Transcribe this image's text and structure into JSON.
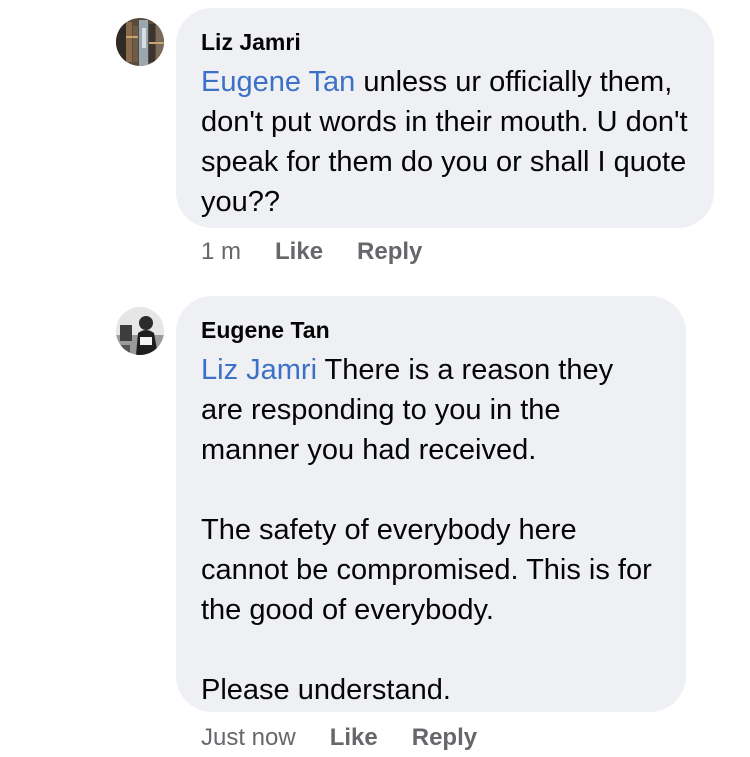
{
  "comments": [
    {
      "author": "Liz Jamri",
      "mention": "Eugene Tan",
      "text": " unless ur officially them, don't put words in their mouth. U don't speak for them do you or shall I quote you??",
      "time": "1 m",
      "like_label": "Like",
      "reply_label": "Reply"
    },
    {
      "author": "Eugene Tan",
      "mention": "Liz Jamri",
      "text": " There is a reason they are responding to you in the manner you had received.\n\nThe safety of everybody here cannot be compromised. This is for the good of everybody.\n\nPlease understand.",
      "time": "Just now",
      "like_label": "Like",
      "reply_label": "Reply"
    }
  ]
}
